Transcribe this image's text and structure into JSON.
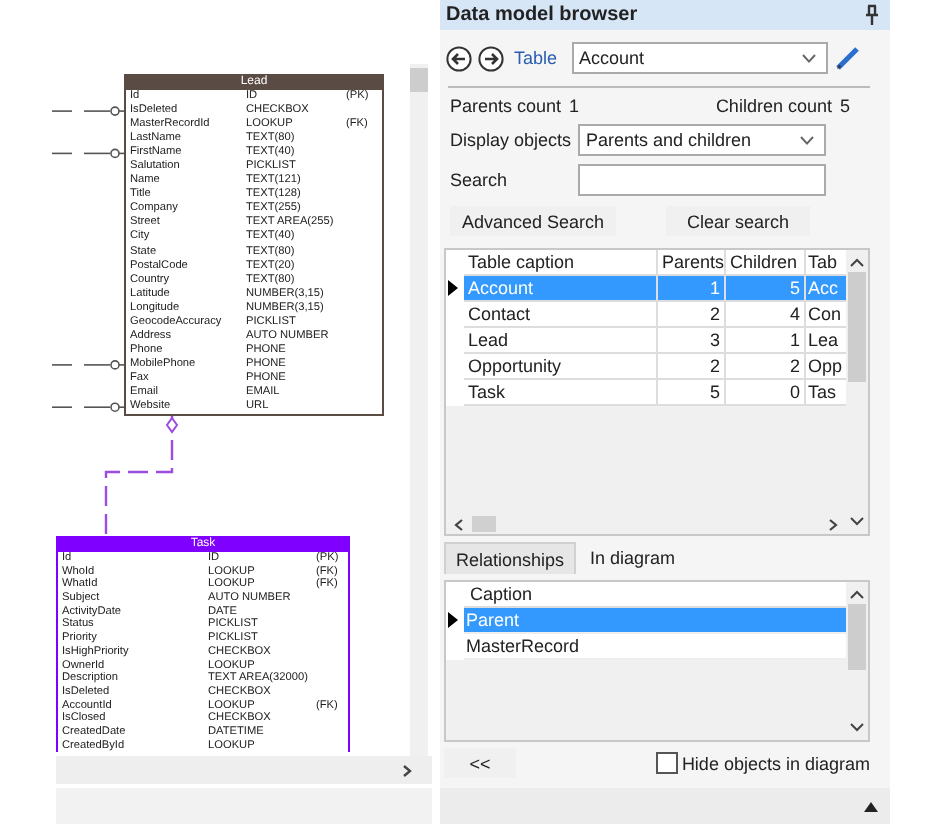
{
  "diagram": {
    "tables": [
      {
        "name": "Lead",
        "color": "#5b4b45",
        "fields": [
          {
            "name": "Id",
            "type": "ID",
            "key": "(PK)",
            "connected": false
          },
          {
            "name": "IsDeleted",
            "type": "CHECKBOX",
            "connected": true
          },
          {
            "name": "MasterRecordId",
            "type": "LOOKUP",
            "key": "(FK)",
            "connected": false
          },
          {
            "name": "LastName",
            "type": "TEXT(80)",
            "connected": false
          },
          {
            "name": "FirstName",
            "type": "TEXT(40)",
            "connected": true
          },
          {
            "name": "Salutation",
            "type": "PICKLIST",
            "connected": false
          },
          {
            "name": "Name",
            "type": "TEXT(121)",
            "connected": false
          },
          {
            "name": "Title",
            "type": "TEXT(128)",
            "connected": false
          },
          {
            "name": "Company",
            "type": "TEXT(255)",
            "connected": false
          },
          {
            "name": "Street",
            "type": "TEXT AREA(255)",
            "connected": false
          },
          {
            "name": "City",
            "type": "TEXT(40)",
            "connected": false
          },
          {
            "name": "State",
            "type": "TEXT(80)",
            "connected": false
          },
          {
            "name": "PostalCode",
            "type": "TEXT(20)",
            "connected": false
          },
          {
            "name": "Country",
            "type": "TEXT(80)",
            "connected": false
          },
          {
            "name": "Latitude",
            "type": "NUMBER(3,15)",
            "connected": false
          },
          {
            "name": "Longitude",
            "type": "NUMBER(3,15)",
            "connected": false
          },
          {
            "name": "GeocodeAccuracy",
            "type": "PICKLIST",
            "connected": false
          },
          {
            "name": "Address",
            "type": "AUTO NUMBER",
            "connected": false
          },
          {
            "name": "Phone",
            "type": "PHONE",
            "connected": false
          },
          {
            "name": "MobilePhone",
            "type": "PHONE",
            "connected": true
          },
          {
            "name": "Fax",
            "type": "PHONE",
            "connected": false
          },
          {
            "name": "Email",
            "type": "EMAIL",
            "connected": false
          },
          {
            "name": "Website",
            "type": "URL",
            "connected": true
          }
        ]
      },
      {
        "name": "Task",
        "color": "#8000ff",
        "fields": [
          {
            "name": "Id",
            "type": "ID",
            "key": "(PK)",
            "connected": false
          },
          {
            "name": "WhoId",
            "type": "LOOKUP",
            "key": "(FK)",
            "connected": false
          },
          {
            "name": "WhatId",
            "type": "LOOKUP",
            "key": "(FK)",
            "connected": false
          },
          {
            "name": "Subject",
            "type": "AUTO NUMBER",
            "connected": false
          },
          {
            "name": "ActivityDate",
            "type": "DATE",
            "connected": false
          },
          {
            "name": "Status",
            "type": "PICKLIST",
            "connected": false
          },
          {
            "name": "Priority",
            "type": "PICKLIST",
            "connected": false
          },
          {
            "name": "IsHighPriority",
            "type": "CHECKBOX",
            "connected": false
          },
          {
            "name": "OwnerId",
            "type": "LOOKUP",
            "connected": false
          },
          {
            "name": "Description",
            "type": "TEXT AREA(32000)",
            "connected": false
          },
          {
            "name": "IsDeleted",
            "type": "CHECKBOX",
            "connected": false
          },
          {
            "name": "AccountId",
            "type": "LOOKUP",
            "key": "(FK)",
            "connected": false
          },
          {
            "name": "IsClosed",
            "type": "CHECKBOX",
            "connected": false
          },
          {
            "name": "CreatedDate",
            "type": "DATETIME",
            "connected": false
          },
          {
            "name": "CreatedById",
            "type": "LOOKUP",
            "connected": false
          }
        ]
      }
    ]
  },
  "panel": {
    "title": "Data model browser",
    "table_label": "Table",
    "table_value": "Account",
    "parents_count_label": "Parents count",
    "parents_count": "1",
    "children_count_label": "Children count",
    "children_count": "5",
    "display_label": "Display objects",
    "display_value": "Parents and children",
    "search_label": "Search",
    "buttons": [
      "Advanced Search",
      "Clear search"
    ],
    "grid": {
      "columns": [
        "Table caption",
        "Parents",
        "Children",
        "Tab"
      ],
      "rows": [
        {
          "cells": [
            "Account",
            "1",
            "5",
            "Acc"
          ],
          "selected": true
        },
        {
          "cells": [
            "Contact",
            "2",
            "4",
            "Con"
          ],
          "selected": false
        },
        {
          "cells": [
            "Lead",
            "3",
            "1",
            "Lea"
          ],
          "selected": false
        },
        {
          "cells": [
            "Opportunity",
            "2",
            "2",
            "Opp"
          ],
          "selected": false
        },
        {
          "cells": [
            "Task",
            "5",
            "0",
            "Tas"
          ],
          "selected": false
        }
      ]
    },
    "tabs": [
      {
        "label": "Relationships",
        "selected": true
      },
      {
        "label": "In diagram",
        "selected": false
      }
    ],
    "relations": {
      "column": "Caption",
      "rows": [
        {
          "caption": "Parent",
          "selected": true
        },
        {
          "caption": "MasterRecord",
          "selected": false
        }
      ]
    },
    "collapse_button": "<<",
    "hide_objects": {
      "label": "Hide objects in diagram",
      "checked": false
    }
  }
}
